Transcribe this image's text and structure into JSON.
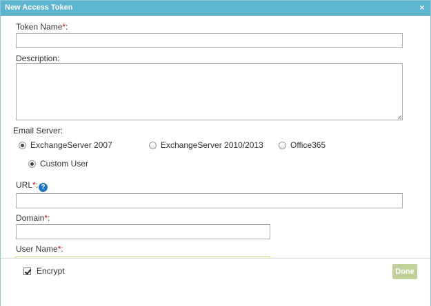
{
  "dialog": {
    "title": "New Access Token",
    "close_glyph": "×",
    "close_icon": "close-icon"
  },
  "form": {
    "token_name": {
      "label": "Token Name",
      "required_mark": "*",
      "suffix": ":",
      "value": ""
    },
    "description": {
      "label": "Description:",
      "value": ""
    },
    "email_server": {
      "label": "Email Server:",
      "options": [
        {
          "label": "ExchangeServer 2007",
          "checked": true
        },
        {
          "label": "ExchangeServer 2010/2013",
          "checked": false
        },
        {
          "label": "Office365",
          "checked": false
        }
      ],
      "custom_user": {
        "label": "Custom User",
        "checked": true
      }
    },
    "url": {
      "label": "URL",
      "required_mark": "*",
      "suffix": ":",
      "help_glyph": "?",
      "help_icon": "help-icon",
      "value": ""
    },
    "domain": {
      "label": "Domain",
      "required_mark": "*",
      "suffix": ":",
      "value": ""
    },
    "user_name": {
      "label": "User Name",
      "required_mark": "*",
      "suffix": ":"
    }
  },
  "footer": {
    "encrypt": {
      "label": "Encrypt",
      "checked": true
    },
    "done_label": "Done"
  },
  "colors": {
    "titlebar": "#5db5cf",
    "required": "#cc0000",
    "done_button": "#c2d19a",
    "help_icon": "#1a74c7"
  }
}
